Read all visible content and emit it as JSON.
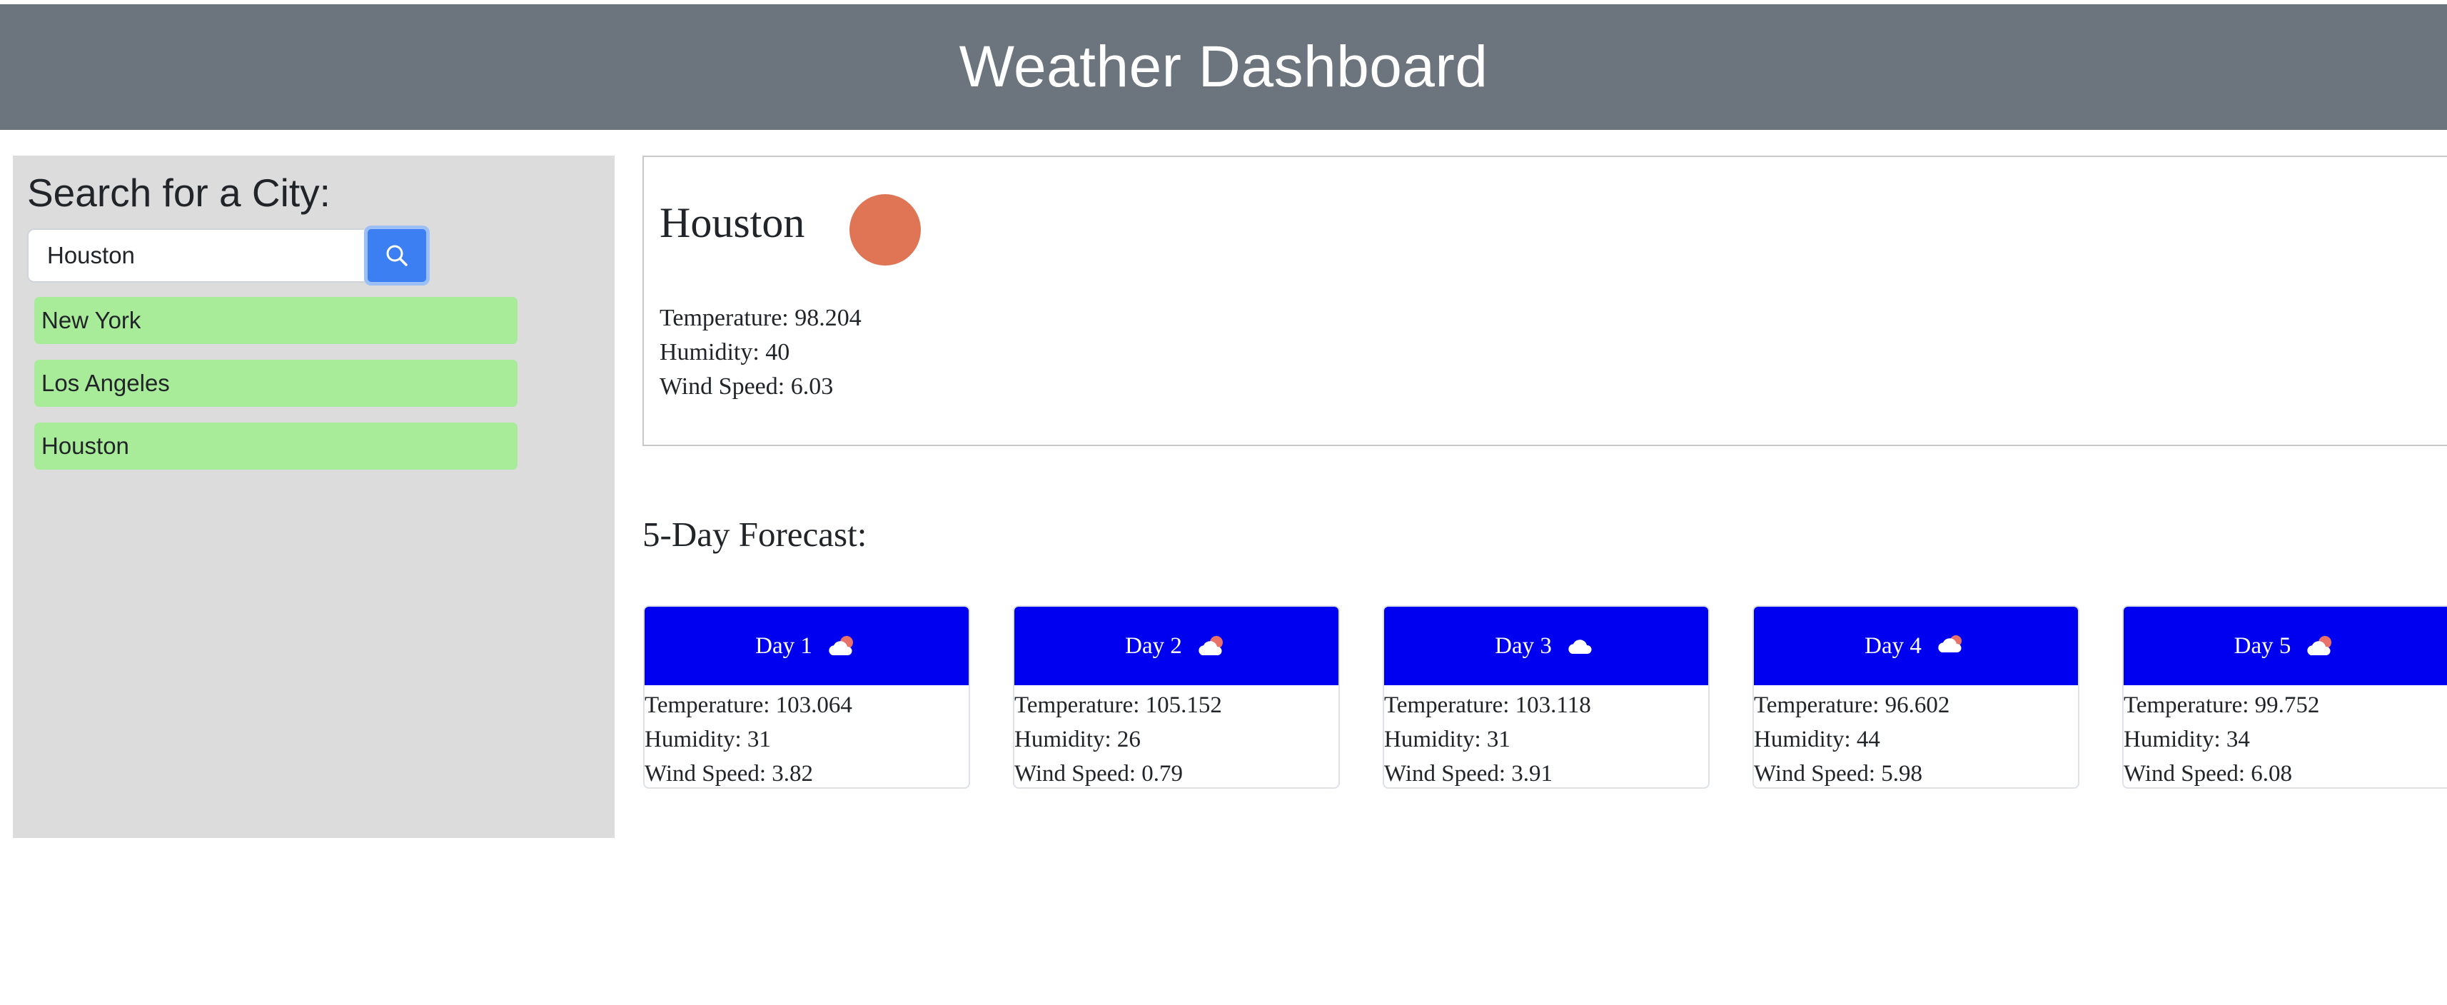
{
  "header": {
    "title": "Weather Dashboard"
  },
  "search": {
    "heading": "Search for a City:",
    "input_value": "Houston",
    "button_icon": "search-icon"
  },
  "history": [
    {
      "label": "New York"
    },
    {
      "label": "Los Angeles"
    },
    {
      "label": "Houston"
    }
  ],
  "current": {
    "city": "Houston",
    "icon": "sun-icon",
    "temperature": "Temperature: 98.204",
    "humidity": "Humidity: 40",
    "wind": "Wind Speed: 6.03"
  },
  "forecast": {
    "title": "5-Day Forecast:",
    "days": [
      {
        "label": "Day 1",
        "icon": "partly-cloudy-icon",
        "temperature": "Temperature: 103.064",
        "humidity": "Humidity: 31",
        "wind": "Wind Speed: 3.82"
      },
      {
        "label": "Day 2",
        "icon": "partly-cloudy-icon",
        "temperature": "Temperature: 105.152",
        "humidity": "Humidity: 26",
        "wind": "Wind Speed: 0.79"
      },
      {
        "label": "Day 3",
        "icon": "cloud-icon",
        "temperature": "Temperature: 103.118",
        "humidity": "Humidity: 31",
        "wind": "Wind Speed: 3.91"
      },
      {
        "label": "Day 4",
        "icon": "partly-cloudy-icon",
        "temperature": "Temperature: 96.602",
        "humidity": "Humidity: 44",
        "wind": "Wind Speed: 5.98"
      },
      {
        "label": "Day 5",
        "icon": "partly-cloudy-icon",
        "temperature": "Temperature: 99.752",
        "humidity": "Humidity: 34",
        "wind": "Wind Speed: 6.08"
      }
    ]
  },
  "colors": {
    "header_bg": "#6c757d",
    "sidebar_bg": "#dcdcdc",
    "history_item_bg": "#a8eb98",
    "search_button_bg": "#3b7ff2",
    "forecast_header_bg": "#0000f0",
    "sun_icon": "#df7555"
  }
}
